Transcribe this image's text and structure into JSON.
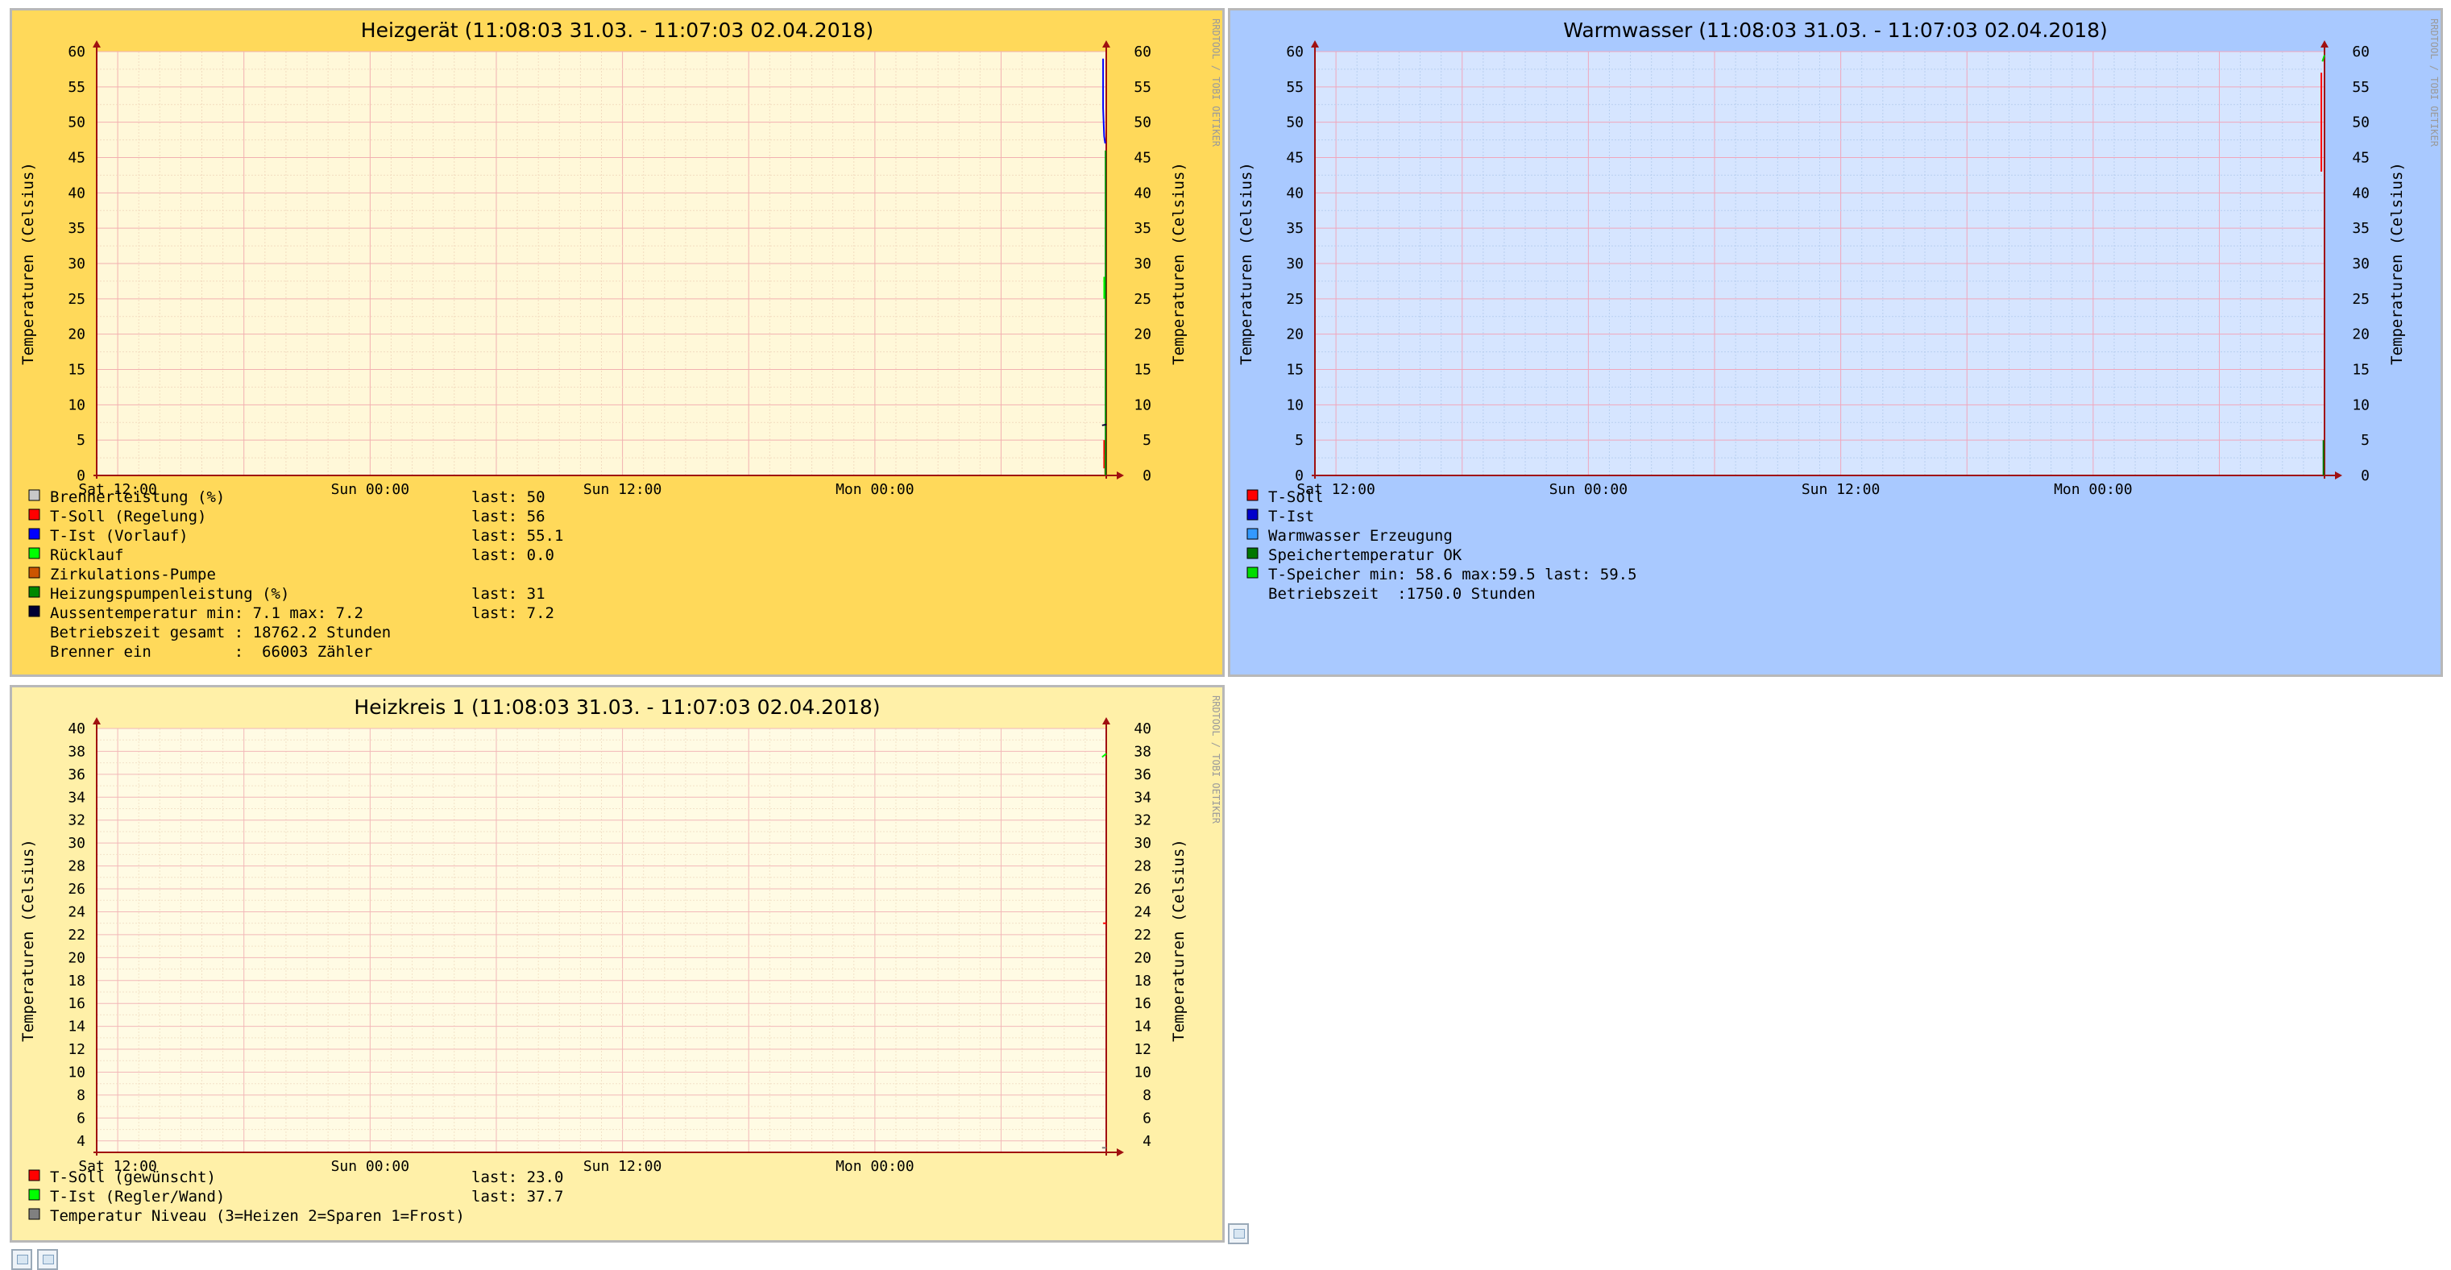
{
  "watermark": "RRDTOOL / TOBI OETIKER",
  "chart_data": [
    {
      "id": "heizgeraet",
      "type": "line",
      "title": "Heizgerät (11:08:03 31.03. - 11:07:03 02.04.2018)",
      "ylabel": "Temperaturen (Celsius)",
      "ylim": [
        0,
        60
      ],
      "yticks": [
        0,
        5,
        10,
        15,
        20,
        25,
        30,
        35,
        40,
        45,
        50,
        55,
        60
      ],
      "xlabels": [
        "Sat 12:00",
        "Sun 00:00",
        "Sun 12:00",
        "Mon 00:00"
      ],
      "xlabel_hours": [
        1,
        13,
        25,
        37
      ],
      "xrange_hours": [
        0,
        48
      ],
      "grid": true,
      "colors": {
        "bg": "#ffd95a",
        "plot": "#fff8d9",
        "major_grid": "#f2b0b0",
        "minor_grid": "#f3dcc0",
        "axis": "#a01010"
      },
      "series": [
        {
          "name": "Brennerleistung (%)",
          "color": "#c8c8c8",
          "text": "last:  50",
          "points": []
        },
        {
          "name": "T-Soll (Regelung)",
          "color": "#ff0000",
          "text": "last:  56",
          "points": [
            [
              47.9,
              1.0
            ],
            [
              47.9,
              5.0
            ]
          ]
        },
        {
          "name": "T-Ist  (Vorlauf)",
          "color": "#0000ff",
          "text": "last:  55.1",
          "points": [
            [
              47.85,
              59.0
            ],
            [
              47.85,
              52.0
            ],
            [
              47.9,
              48.0
            ],
            [
              47.95,
              47.0
            ]
          ]
        },
        {
          "name": "Rücklauf",
          "color": "#00ff00",
          "text": "last:  0.0",
          "points": [
            [
              47.9,
              25.0
            ],
            [
              47.9,
              28.0
            ],
            [
              48.0,
              28.0
            ]
          ]
        },
        {
          "name": "Zirkulations-Pumpe",
          "color": "#cc5500",
          "text": "",
          "points": [
            [
              47.95,
              0.0
            ],
            [
              47.95,
              3.0
            ]
          ]
        },
        {
          "name": "Heizungspumpenleistung (%)",
          "color": "#008800",
          "text": "last:  31",
          "points": [
            [
              47.97,
              0.0
            ],
            [
              47.97,
              46.0
            ]
          ]
        },
        {
          "name": "Aussentemperatur min:  7.1  max:   7.2",
          "color": "#000033",
          "text": "last:  7.2",
          "points": [
            [
              47.8,
              7.1
            ],
            [
              48.0,
              7.2
            ]
          ]
        }
      ],
      "extra_lines": [
        "Betriebszeit gesamt : 18762.2 Stunden",
        "Brenner ein         :  66003 Zähler"
      ]
    },
    {
      "id": "warmwasser",
      "type": "line",
      "title": "Warmwasser (11:08:03 31.03. - 11:07:03 02.04.2018)",
      "ylabel": "Temperaturen (Celsius)",
      "ylim": [
        0,
        60
      ],
      "yticks": [
        0,
        5,
        10,
        15,
        20,
        25,
        30,
        35,
        40,
        45,
        50,
        55,
        60
      ],
      "xlabels": [
        "Sat 12:00",
        "Sun 00:00",
        "Sun 12:00",
        "Mon 00:00"
      ],
      "xlabel_hours": [
        1,
        13,
        25,
        37
      ],
      "xrange_hours": [
        0,
        48
      ],
      "grid": true,
      "colors": {
        "bg": "#a9c9ff",
        "plot": "#d6e5ff",
        "major_grid": "#f0a6bc",
        "minor_grid": "#b8cff0",
        "axis": "#a01010"
      },
      "series": [
        {
          "name": "T-Soll",
          "color": "#ff0000",
          "text": "",
          "points": [
            [
              47.85,
              43.0
            ],
            [
              47.85,
              57.0
            ]
          ]
        },
        {
          "name": "T-Ist",
          "color": "#0000cc",
          "text": "",
          "points": []
        },
        {
          "name": "Warmwasser Erzeugung",
          "color": "#3399ff",
          "text": "",
          "points": []
        },
        {
          "name": "Speichertemperatur OK",
          "color": "#007700",
          "text": "",
          "points": [
            [
              47.95,
              0.0
            ],
            [
              47.95,
              5.0
            ]
          ]
        },
        {
          "name": "T-Speicher min:  58.6  max:59.5  last:  59.5",
          "color": "#00dd00",
          "text": "",
          "points": [
            [
              47.9,
              58.6
            ],
            [
              48.0,
              59.5
            ]
          ]
        }
      ],
      "extra_lines": [
        "Betriebszeit  :1750.0 Stunden"
      ]
    },
    {
      "id": "heizkreis",
      "type": "line",
      "title": "Heizkreis 1 (11:08:03 31.03. - 11:07:03 02.04.2018)",
      "ylabel": "Temperaturen (Celsius)",
      "ylim": [
        3,
        40
      ],
      "yticks": [
        4,
        6,
        8,
        10,
        12,
        14,
        16,
        18,
        20,
        22,
        24,
        26,
        28,
        30,
        32,
        34,
        36,
        38,
        40
      ],
      "xlabels": [
        "Sat 12:00",
        "Sun 00:00",
        "Sun 12:00",
        "Mon 00:00"
      ],
      "xlabel_hours": [
        1,
        13,
        25,
        37
      ],
      "xrange_hours": [
        0,
        48
      ],
      "grid": true,
      "colors": {
        "bg": "#fff0a8",
        "plot": "#fffbe4",
        "major_grid": "#f2b8b8",
        "minor_grid": "#f3e2c8",
        "axis": "#a01010"
      },
      "series": [
        {
          "name": "T-Soll (gewünscht)",
          "color": "#ff0000",
          "text": "last:  23.0",
          "points": [
            [
              47.85,
              23.0
            ],
            [
              48.0,
              23.0
            ]
          ]
        },
        {
          "name": "T-Ist  (Regler/Wand)",
          "color": "#00ff00",
          "text": "last:  37.7",
          "points": [
            [
              47.8,
              37.5
            ],
            [
              48.0,
              37.8
            ]
          ]
        },
        {
          "name": "Temperatur Niveau (3=Heizen 2=Sparen 1=Frost)",
          "color": "#808080",
          "text": "",
          "points": [
            [
              47.8,
              3.4
            ],
            [
              48.0,
              3.4
            ]
          ]
        }
      ],
      "extra_lines": []
    }
  ]
}
